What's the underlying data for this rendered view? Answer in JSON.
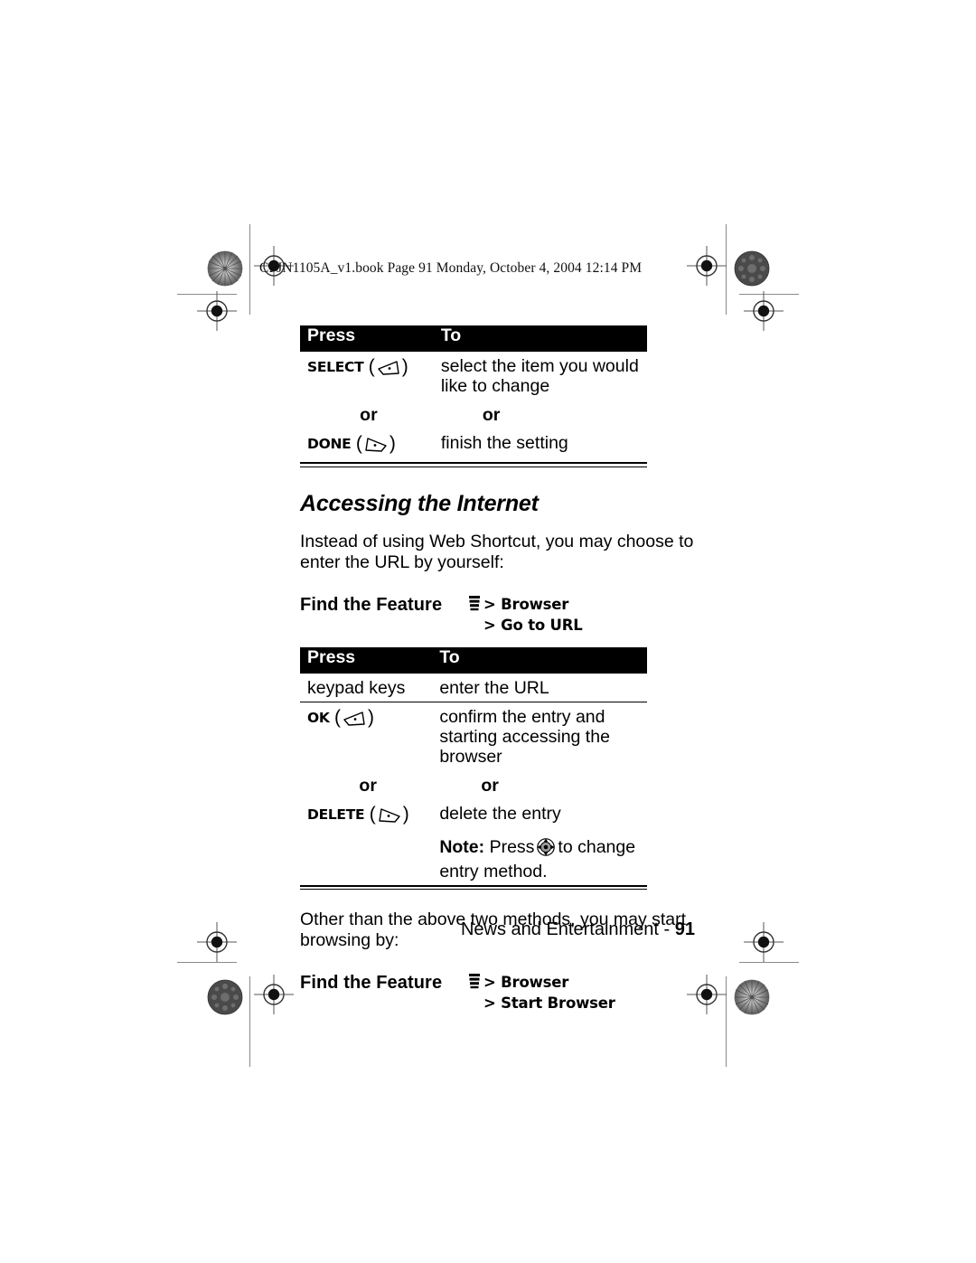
{
  "book_header": "CFJN1105A_v1.book  Page 91  Monday, October 4, 2004  12:14 PM",
  "table1": {
    "headers": {
      "press": "Press",
      "to": "To"
    },
    "rows": [
      {
        "press_label": "SELECT",
        "press_icon": "left-softkey-icon",
        "to": "select the item you would like to change"
      },
      {
        "press_label": "or",
        "to": "or"
      },
      {
        "press_label": "DONE",
        "press_icon": "right-softkey-icon",
        "to": "finish the setting"
      }
    ]
  },
  "section": {
    "heading": "Accessing the Internet",
    "paragraph": "Instead of using Web Shortcut, you may choose to enter the URL by yourself:"
  },
  "find_feature_1": {
    "label": "Find the Feature",
    "icon": "menu-icon",
    "path_line1": "> Browser",
    "path_line2": "> Go to URL"
  },
  "table2": {
    "headers": {
      "press": "Press",
      "to": "To"
    },
    "rows": [
      {
        "press_label": "keypad keys",
        "to": "enter the URL"
      },
      {
        "press_label": "OK",
        "press_icon": "left-softkey-icon",
        "to": "confirm the entry and starting accessing the browser"
      },
      {
        "press_label": "or",
        "to": "or"
      },
      {
        "press_label": "DELETE",
        "press_icon": "right-softkey-icon",
        "to": "delete the entry"
      }
    ],
    "note": {
      "label": "Note:",
      "text_before": "Press",
      "icon": "navigation-key-icon",
      "text_after": "to change entry method."
    }
  },
  "paragraph_2": "Other than the above two methods, you may start browsing by:",
  "find_feature_2": {
    "label": "Find the Feature",
    "icon": "menu-icon",
    "path_line1": "> Browser",
    "path_line2": "> Start Browser"
  },
  "footer": {
    "text": "News and Entertainment - ",
    "page": "91"
  }
}
